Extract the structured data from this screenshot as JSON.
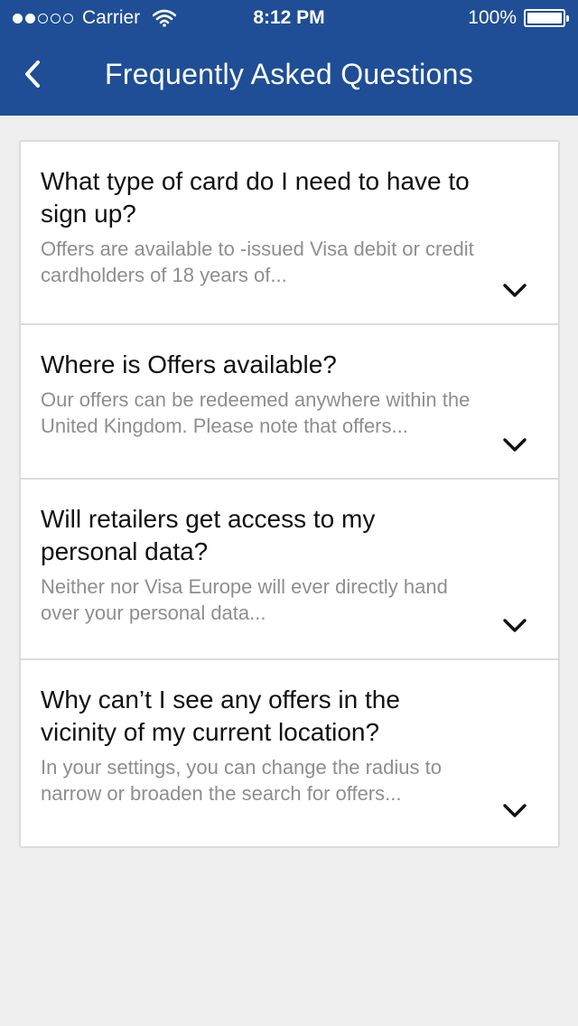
{
  "status_bar": {
    "carrier": "Carrier",
    "time": "8:12 PM",
    "battery": "100%"
  },
  "header": {
    "title": "Frequently Asked Questions",
    "background": "#1f4e96"
  },
  "faqs": [
    {
      "question": "What type of card do I need to have to sign up?",
      "answer": "Offers are available to -issued Visa debit or credit cardholders of 18 years of..."
    },
    {
      "question": "Where is  Offers available?",
      "answer": "Our offers can be redeemed anywhere within the United Kingdom. Please note that offers..."
    },
    {
      "question": "Will retailers get access to my personal data?",
      "answer": "Neither  nor Visa Europe will ever directly hand over your personal data..."
    },
    {
      "question": "Why can’t I see any offers in the vicinity of my current location?",
      "answer": "In your settings, you can change the radius to narrow or broaden the search for offers..."
    }
  ]
}
